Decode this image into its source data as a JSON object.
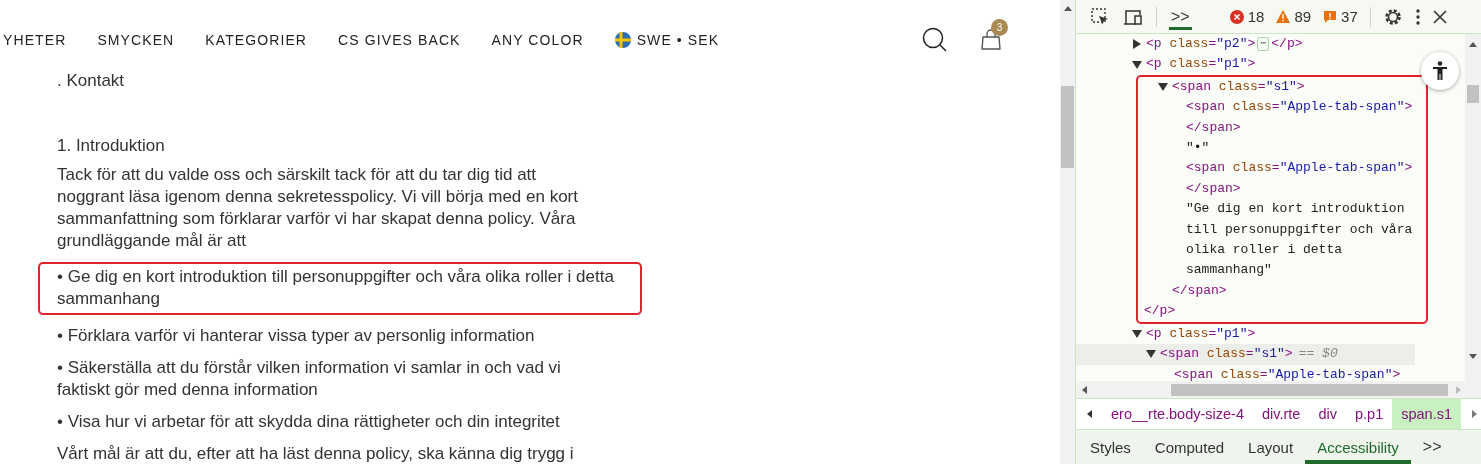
{
  "nav": {
    "items": [
      {
        "label": "YHETER"
      },
      {
        "label": "SMYCKEN"
      },
      {
        "label": "KATEGORIER"
      },
      {
        "label": "CS GIVES BACK"
      },
      {
        "label": "ANY COLOR"
      }
    ],
    "region": {
      "label": "SWE • SEK"
    },
    "cart_count": "3"
  },
  "article": {
    "blocks": [
      {
        "kind": "text",
        "text": ". Kontakt",
        "annotated": false
      },
      {
        "kind": "heading",
        "text": "1. Introduktion",
        "annotated": false
      },
      {
        "kind": "text",
        "text": "Tack för att du valde oss och särskilt tack för att du tar dig tid att noggrant läsa igenom denna sekretesspolicy. Vi vill börja med en kort sammanfattning som förklarar varför vi har skapat denna policy. Våra grundläggande mål är att",
        "annotated": false
      },
      {
        "kind": "text",
        "text": "• Ge dig en kort introduktion till personuppgifter och våra olika roller i detta sammanhang",
        "annotated": true
      },
      {
        "kind": "text",
        "text": "• Förklara varför vi hanterar vissa typer av personlig information",
        "annotated": false
      },
      {
        "kind": "text",
        "text": "• Säkerställa att du förstår vilken information vi samlar in och vad vi faktiskt gör med denna information",
        "annotated": false
      },
      {
        "kind": "text",
        "text": "• Visa hur vi arbetar för att skydda dina rättigheter och din integritet",
        "annotated": false
      },
      {
        "kind": "text",
        "text": "Vårt mål är att du, efter att ha läst denna policy, ska känna dig trygg i",
        "annotated": false
      }
    ]
  },
  "devtools": {
    "toolbar": {
      "errors": "18",
      "warnings": "89",
      "issues": "37",
      "more_tabs": ">>"
    },
    "tree": [
      {
        "kind": "element",
        "open": [
          {
            "kind": "tag",
            "s": "<p "
          },
          {
            "kind": "attr",
            "s": "class"
          },
          {
            "kind": "tag",
            "s": "="
          },
          {
            "kind": "val",
            "s": "\"p2\""
          },
          {
            "kind": "tag",
            "s": ">"
          }
        ],
        "expanded": false,
        "ellipsis": "⋯",
        "close": "</p>",
        "selected": false
      },
      {
        "kind": "element",
        "open": [
          {
            "kind": "tag",
            "s": "<p "
          },
          {
            "kind": "attr",
            "s": "class"
          },
          {
            "kind": "tag",
            "s": "="
          },
          {
            "kind": "val",
            "s": "\"p1\""
          },
          {
            "kind": "tag",
            "s": ">"
          }
        ],
        "expanded": true,
        "close": "</p>",
        "selected": false,
        "annotated": true,
        "children": [
          {
            "kind": "element",
            "open": [
              {
                "kind": "tag",
                "s": "<span "
              },
              {
                "kind": "attr",
                "s": "class"
              },
              {
                "kind": "tag",
                "s": "="
              },
              {
                "kind": "val",
                "s": "\"s1\""
              },
              {
                "kind": "tag",
                "s": ">"
              }
            ],
            "expanded": true,
            "close": "</span>",
            "selected": false,
            "children": [
              {
                "kind": "element",
                "open": [
                  {
                    "kind": "tag",
                    "s": "<span "
                  },
                  {
                    "kind": "attr",
                    "s": "class"
                  },
                  {
                    "kind": "tag",
                    "s": "="
                  },
                  {
                    "kind": "val",
                    "s": "\"Apple-tab-span\""
                  },
                  {
                    "kind": "tag",
                    "s": ">"
                  }
                ],
                "close": "</span>",
                "selected": false
              },
              {
                "kind": "text",
                "text": "\"•\""
              },
              {
                "kind": "element",
                "open": [
                  {
                    "kind": "tag",
                    "s": "<span "
                  },
                  {
                    "kind": "attr",
                    "s": "class"
                  },
                  {
                    "kind": "tag",
                    "s": "="
                  },
                  {
                    "kind": "val",
                    "s": "\"Apple-tab-span\""
                  },
                  {
                    "kind": "tag",
                    "s": ">"
                  }
                ],
                "close": "</span>",
                "selected": false
              },
              {
                "kind": "text",
                "text": "\"Ge dig en kort introduktion till personuppgifter och våra olika roller i detta sammanhang\""
              }
            ]
          }
        ]
      },
      {
        "kind": "element",
        "open": [
          {
            "kind": "tag",
            "s": "<p "
          },
          {
            "kind": "attr",
            "s": "class"
          },
          {
            "kind": "tag",
            "s": "="
          },
          {
            "kind": "val",
            "s": "\"p1\""
          },
          {
            "kind": "tag",
            "s": ">"
          }
        ],
        "expanded": true,
        "selected": false,
        "children": [
          {
            "kind": "element",
            "open": [
              {
                "kind": "tag",
                "s": "<span "
              },
              {
                "kind": "attr",
                "s": "class"
              },
              {
                "kind": "tag",
                "s": "="
              },
              {
                "kind": "val",
                "s": "\"s1\""
              },
              {
                "kind": "tag",
                "s": ">"
              }
            ],
            "expanded": true,
            "suffix": "== $0",
            "selected": true,
            "children": [
              {
                "kind": "element",
                "open": [
                  {
                    "kind": "tag",
                    "s": "<span "
                  },
                  {
                    "kind": "attr",
                    "s": "class"
                  },
                  {
                    "kind": "tag",
                    "s": "="
                  },
                  {
                    "kind": "val",
                    "s": "\"Apple-tab-span\""
                  },
                  {
                    "kind": "tag",
                    "s": ">"
                  }
                ],
                "selected": false
              }
            ]
          }
        ]
      }
    ],
    "breadcrumbs": [
      {
        "label": "ero__rte.body-size-4",
        "selected": false
      },
      {
        "label": "div.rte",
        "selected": false
      },
      {
        "label": "div",
        "selected": false
      },
      {
        "label": "p.p1",
        "selected": false
      },
      {
        "label": "span.s1",
        "selected": true
      }
    ],
    "tabs": [
      {
        "label": "Styles",
        "selected": false
      },
      {
        "label": "Computed",
        "selected": false
      },
      {
        "label": "Layout",
        "selected": false
      },
      {
        "label": "Accessibility",
        "selected": true
      }
    ],
    "tabs_more": ">>"
  }
}
